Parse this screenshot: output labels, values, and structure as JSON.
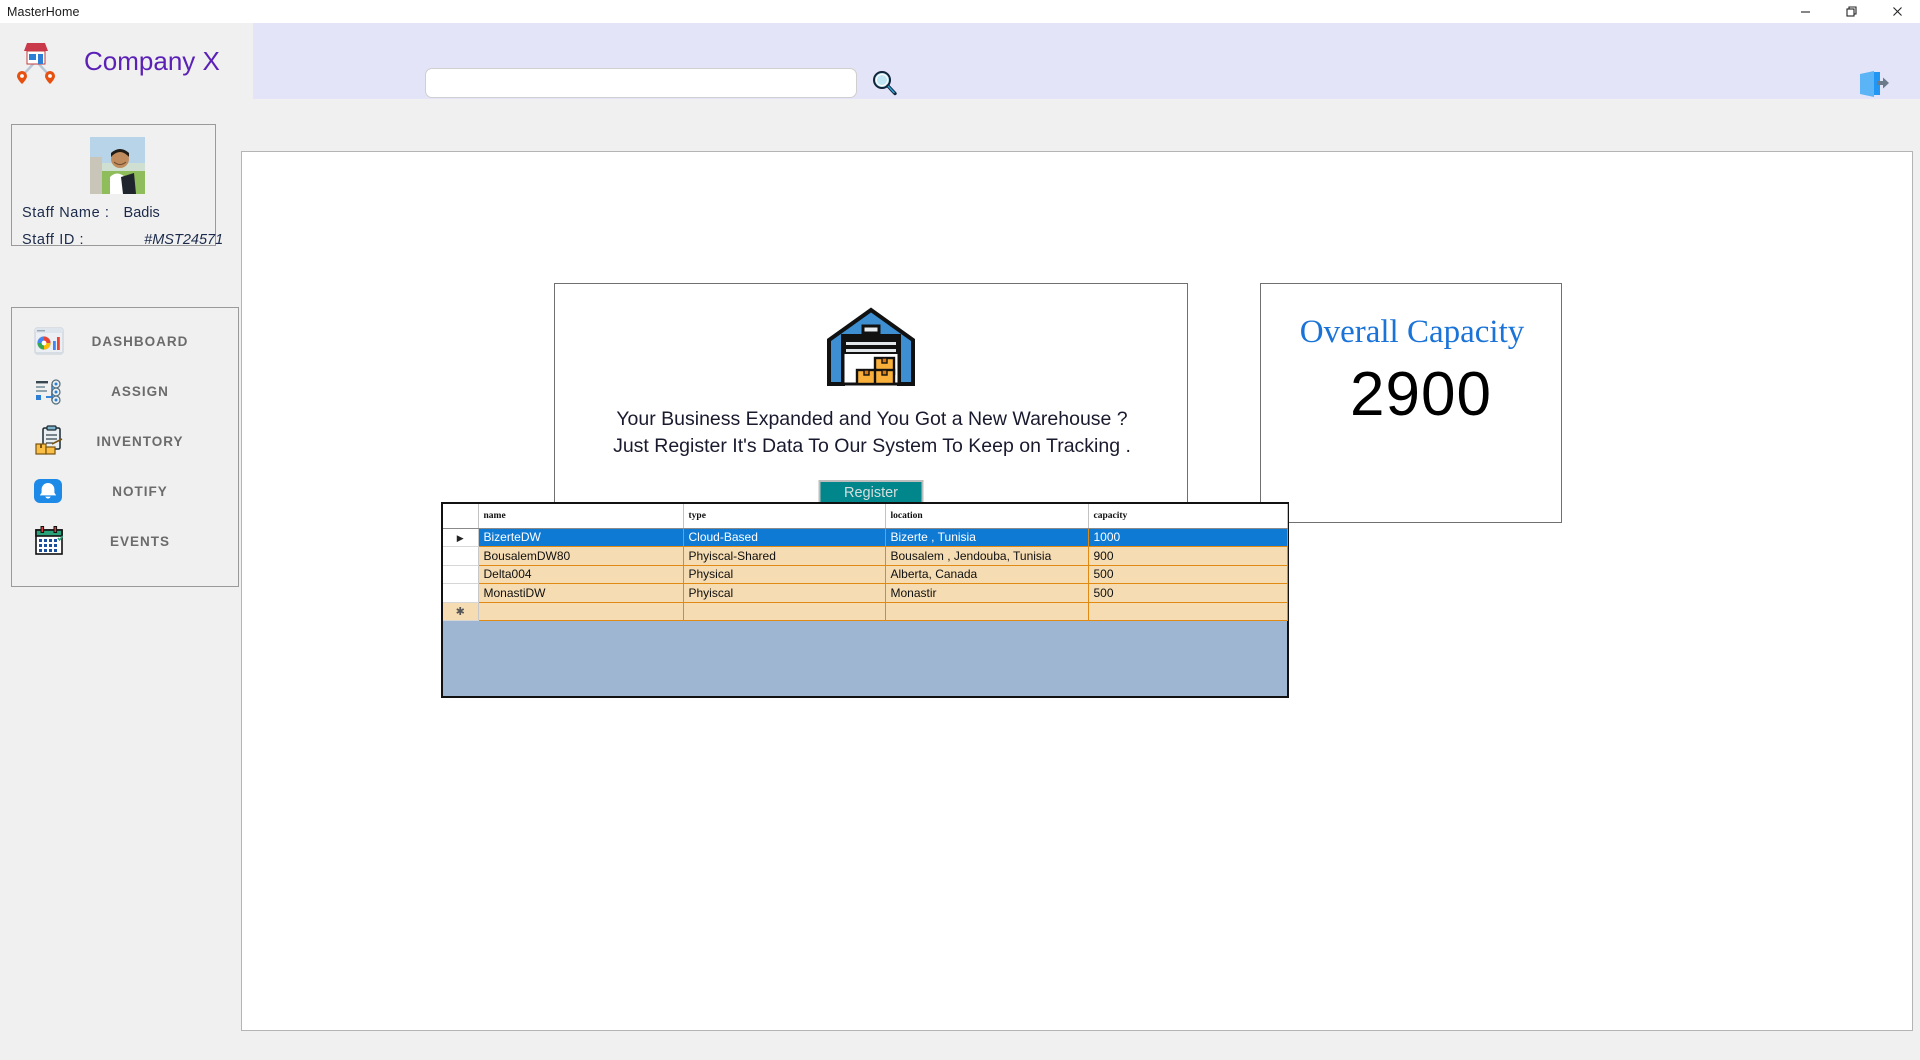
{
  "window": {
    "title": "MasterHome",
    "controls": [
      {
        "name": "minimize",
        "glyph": "minimize-icon"
      },
      {
        "name": "maximize",
        "glyph": "restore-icon"
      },
      {
        "name": "close",
        "glyph": "close-icon"
      }
    ]
  },
  "header": {
    "brand": "Company X",
    "logo_icon": "store-network-icon",
    "search": {
      "value": "",
      "placeholder": ""
    },
    "search_icon": "magnifier-icon",
    "logout_icon": "logout-door-icon"
  },
  "sidebar": {
    "profile": {
      "avatar_icon": "user-photo",
      "name_label": "Staff  Name :",
      "name_value": "Badis",
      "id_label": "Staff ID :",
      "id_value": "#MST24571"
    },
    "items": [
      {
        "label": "DASHBOARD",
        "icon": "dashboard-icon"
      },
      {
        "label": "ASSIGN",
        "icon": "assign-icon"
      },
      {
        "label": "INVENTORY",
        "icon": "inventory-clipboard-icon"
      },
      {
        "label": "NOTIFY",
        "icon": "bell-icon"
      },
      {
        "label": "EVENTS",
        "icon": "calendar-icon"
      }
    ]
  },
  "main": {
    "promo": {
      "icon": "warehouse-icon",
      "line1": "Your Business Expanded and You Got a New  Warehouse ?",
      "line2": "Just Register It's Data To Our System To Keep on Tracking .",
      "button": "Register"
    },
    "capacity": {
      "title": "Overall Capacity",
      "value": "2900"
    },
    "grid": {
      "columns": [
        "name",
        "type",
        "location",
        "capacity"
      ],
      "rows": [
        {
          "marker": "▶",
          "name": "BizerteDW",
          "type": "Cloud-Based",
          "location": "Bizerte , Tunisia",
          "capacity": "1000",
          "selected": true
        },
        {
          "marker": "",
          "name": "BousalemDW80",
          "type": "Phyiscal-Shared",
          "location": "Bousalem , Jendouba, Tunisia",
          "capacity": "900",
          "selected": false
        },
        {
          "marker": "",
          "name": "Delta004",
          "type": "Physical",
          "location": "Alberta, Canada",
          "capacity": "500",
          "selected": false
        },
        {
          "marker": "",
          "name": "MonastiDW",
          "type": "Phyiscal",
          "location": "Monastir",
          "capacity": "500",
          "selected": false
        },
        {
          "marker": "✱",
          "name": "",
          "type": "",
          "location": "",
          "capacity": "",
          "selected": false
        }
      ]
    }
  },
  "colors": {
    "brand_purple": "#5b21b6",
    "header_band": "#e4e4f8",
    "capacity_blue": "#1a73d8",
    "register_teal": "#00868b",
    "row_tan": "#f5dcb3",
    "row_selected": "#0f7ad4",
    "grid_backdrop": "#9eb6d2",
    "grid_line_orange": "#e08a14"
  }
}
